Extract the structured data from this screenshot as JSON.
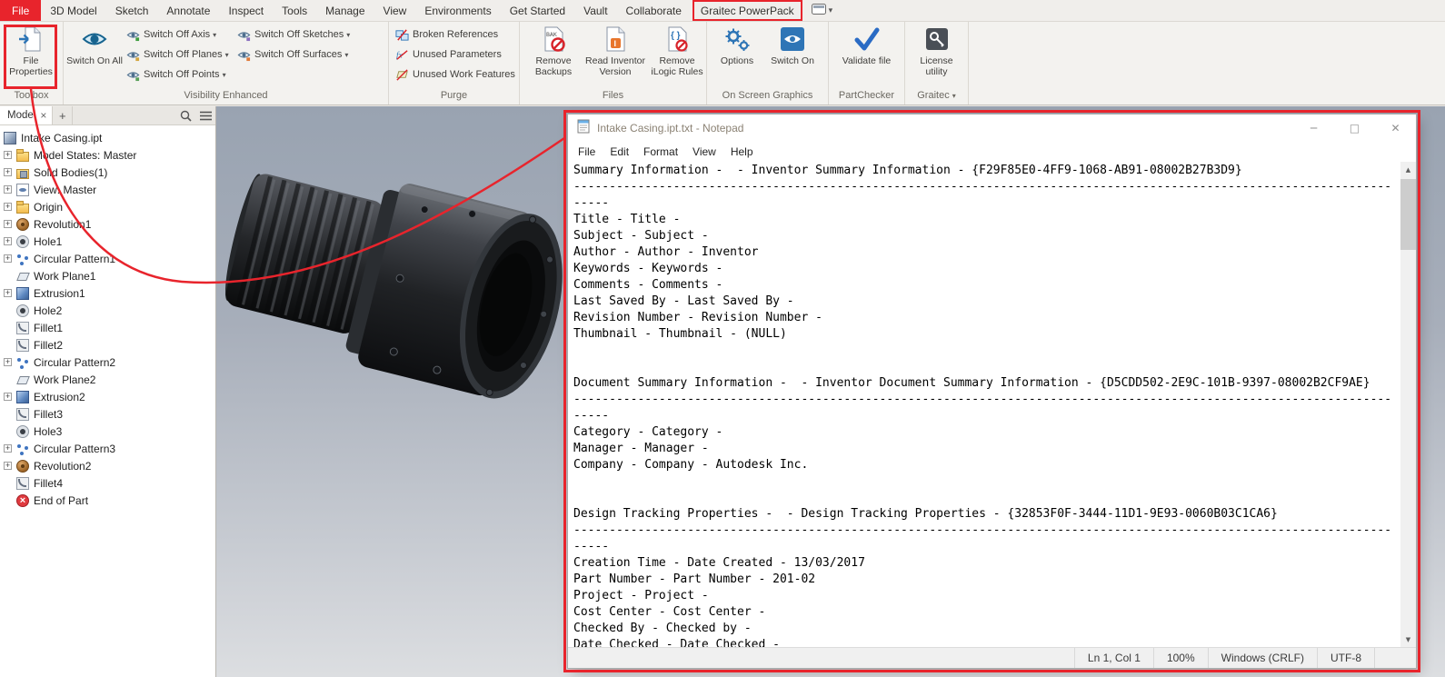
{
  "colors": {
    "annotation": "#e8242c",
    "ribbon_icon_blue": "#2e75b6",
    "file_tab_red": "#e8242c"
  },
  "menubar": {
    "items": [
      {
        "label": "File",
        "cls": "m-file"
      },
      {
        "label": "3D Model"
      },
      {
        "label": "Sketch"
      },
      {
        "label": "Annotate"
      },
      {
        "label": "Inspect"
      },
      {
        "label": "Tools"
      },
      {
        "label": "Manage"
      },
      {
        "label": "View"
      },
      {
        "label": "Environments"
      },
      {
        "label": "Get Started"
      },
      {
        "label": "Vault"
      },
      {
        "label": "Collaborate"
      },
      {
        "label": "Graitec PowerPack",
        "cls": "m-boxed"
      }
    ]
  },
  "ribbon": {
    "group_labels": {
      "toolbox": "Toolbox",
      "visibility": "Visibility Enhanced",
      "purge": "Purge",
      "files": "Files",
      "osg": "On Screen Graphics",
      "partchecker": "PartChecker",
      "graitec": "Graitec"
    },
    "buttons": {
      "file_properties": "File Properties",
      "switch_on_all": "Switch On All",
      "switch_off_axis": "Switch Off Axis",
      "switch_off_planes": "Switch Off Planes",
      "switch_off_points": "Switch Off Points",
      "switch_off_sketches": "Switch Off Sketches",
      "switch_off_surfaces": "Switch Off Surfaces",
      "broken_references": "Broken References",
      "unused_parameters": "Unused Parameters",
      "unused_work_features": "Unused Work Features",
      "remove_backups": "Remove Backups",
      "read_inventor_version": "Read Inventor Version",
      "remove_ilogic_rules": "Remove iLogic Rules",
      "options": "Options",
      "switch_on": "Switch On",
      "validate_file": "Validate file",
      "license_utility": "License utility"
    }
  },
  "browser": {
    "tab_label": "Model",
    "tree": [
      {
        "label": "Intake Casing.ipt",
        "icon": "i-part",
        "exp": false,
        "cls": "root-row"
      },
      {
        "label": "Model States: Master",
        "icon": "i-folder",
        "exp": true
      },
      {
        "label": "Solid Bodies(1)",
        "icon": "i-solid",
        "exp": true
      },
      {
        "label": "View: Master",
        "icon": "i-view",
        "exp": true
      },
      {
        "label": "Origin",
        "icon": "i-folder",
        "exp": true
      },
      {
        "label": "Revolution1",
        "icon": "i-revolve",
        "exp": true
      },
      {
        "label": "Hole1",
        "icon": "i-hole",
        "exp": true
      },
      {
        "label": "Circular Pattern1",
        "icon": "i-pattern",
        "exp": true
      },
      {
        "label": "Work Plane1",
        "icon": "i-plane",
        "exp": false
      },
      {
        "label": "Extrusion1",
        "icon": "i-extrude",
        "exp": true
      },
      {
        "label": "Hole2",
        "icon": "i-hole",
        "exp": false
      },
      {
        "label": "Fillet1",
        "icon": "i-fillet",
        "exp": false
      },
      {
        "label": "Fillet2",
        "icon": "i-fillet",
        "exp": false
      },
      {
        "label": "Circular Pattern2",
        "icon": "i-pattern",
        "exp": true
      },
      {
        "label": "Work Plane2",
        "icon": "i-plane",
        "exp": false
      },
      {
        "label": "Extrusion2",
        "icon": "i-extrude",
        "exp": true
      },
      {
        "label": "Fillet3",
        "icon": "i-fillet",
        "exp": false
      },
      {
        "label": "Hole3",
        "icon": "i-hole",
        "exp": false
      },
      {
        "label": "Circular Pattern3",
        "icon": "i-pattern",
        "exp": true
      },
      {
        "label": "Revolution2",
        "icon": "i-revolve",
        "exp": true
      },
      {
        "label": "Fillet4",
        "icon": "i-fillet",
        "exp": false
      },
      {
        "label": "End of Part",
        "icon": "i-eop",
        "exp": false
      }
    ]
  },
  "notepad": {
    "title": "Intake Casing.ipt.txt - Notepad",
    "menu": [
      "File",
      "Edit",
      "Format",
      "View",
      "Help"
    ],
    "lines": [
      "Summary Information -  - Inventor Summary Information - {F29F85E0-4FF9-1068-AB91-08002B27B3D9}",
      "-------------------------------------------------------------------------------------------------------------------",
      "-----",
      "Title - Title -",
      "Subject - Subject -",
      "Author - Author - Inventor",
      "Keywords - Keywords -",
      "Comments - Comments -",
      "Last Saved By - Last Saved By -",
      "Revision Number - Revision Number -",
      "Thumbnail - Thumbnail - (NULL)",
      "",
      "",
      "Document Summary Information -  - Inventor Document Summary Information - {D5CDD502-2E9C-101B-9397-08002B2CF9AE}",
      "-------------------------------------------------------------------------------------------------------------------",
      "-----",
      "Category - Category -",
      "Manager - Manager -",
      "Company - Company - Autodesk Inc.",
      "",
      "",
      "Design Tracking Properties -  - Design Tracking Properties - {32853F0F-3444-11D1-9E93-0060B03C1CA6}",
      "-------------------------------------------------------------------------------------------------------------------",
      "-----",
      "Creation Time - Date Created - 13/03/2017",
      "Part Number - Part Number - 201-02",
      "Project - Project -",
      "Cost Center - Cost Center -",
      "Checked By - Checked by -",
      "Date Checked - Date Checked -"
    ],
    "status": {
      "cursor": "Ln 1, Col 1",
      "zoom": "100%",
      "line_ending": "Windows (CRLF)",
      "encoding": "UTF-8"
    }
  }
}
